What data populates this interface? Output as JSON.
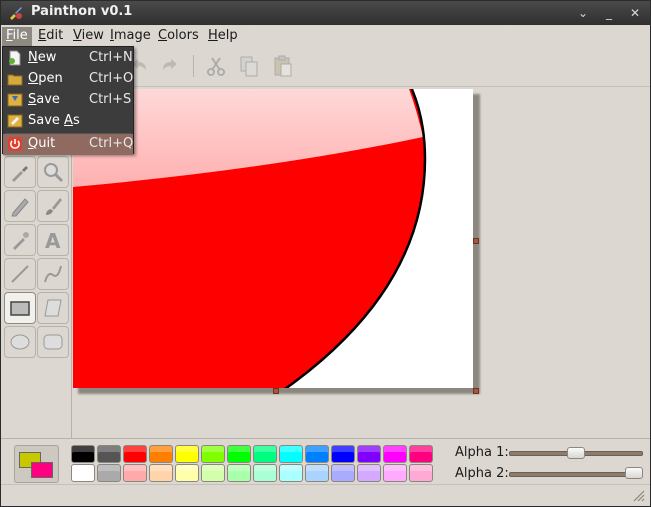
{
  "window": {
    "title": "Painthon v0.1",
    "controls": [
      "chevron-down",
      "minimize",
      "close"
    ]
  },
  "menubar": {
    "items": [
      {
        "label": "File",
        "mnemonic": "F",
        "rest": "ile"
      },
      {
        "label": "Edit",
        "mnemonic": "E",
        "rest": "dit"
      },
      {
        "label": "View",
        "mnemonic": "V",
        "rest": "iew"
      },
      {
        "label": "Image",
        "mnemonic": "I",
        "rest": "mage"
      },
      {
        "label": "Colors",
        "mnemonic": "C",
        "rest": "olors"
      },
      {
        "label": "Help",
        "mnemonic": "H",
        "rest": "elp"
      }
    ],
    "active": "File"
  },
  "file_menu": {
    "items": [
      {
        "label": "New",
        "mnemonic": "N",
        "rest": "ew",
        "accel": "Ctrl+N",
        "icon": "new-document-icon"
      },
      {
        "label": "Open",
        "mnemonic": "O",
        "rest": "pen",
        "accel": "Ctrl+O",
        "icon": "open-folder-icon"
      },
      {
        "label": "Save",
        "mnemonic": "S",
        "rest": "ave",
        "accel": "Ctrl+S",
        "icon": "save-icon"
      },
      {
        "label": "Save As",
        "mnemonic_pre": "Save ",
        "mnemonic": "A",
        "rest": "s",
        "accel": "",
        "icon": "save-as-icon"
      },
      {
        "label": "Quit",
        "mnemonic": "Q",
        "rest": "uit",
        "accel": "Ctrl+Q",
        "icon": "quit-icon"
      }
    ],
    "highlighted": "Quit"
  },
  "toolbar": {
    "buttons": [
      "undo-icon",
      "redo-icon",
      "cut-icon",
      "copy-icon",
      "paste-icon"
    ]
  },
  "tools": [
    "color-picker-icon",
    "magnifier-icon",
    "pencil-icon",
    "paintbrush-icon",
    "airbrush-icon",
    "text-icon",
    "line-icon",
    "curve-icon",
    "rectangle-icon",
    "free-shape-icon",
    "ellipse-icon",
    "rounded-rectangle-icon"
  ],
  "active_tool": "rectangle-icon",
  "palette": {
    "row1": [
      "#000000",
      "#555555",
      "#ff0000",
      "#ff7f00",
      "#ffff00",
      "#80ff00",
      "#00ff00",
      "#00ff80",
      "#00ffff",
      "#0080ff",
      "#0000ff",
      "#8000ff",
      "#ff00ff",
      "#ff0080"
    ],
    "row2": [
      "#ffffff",
      "#aaaaaa",
      "#ffaaaa",
      "#ffd4aa",
      "#ffffaa",
      "#d4ffaa",
      "#aaffaa",
      "#aaffd4",
      "#aaffff",
      "#aad4ff",
      "#aaaaff",
      "#d4aaff",
      "#ffaaff",
      "#ffaad4"
    ],
    "primary": "#c8c800",
    "secondary": "#ff0080"
  },
  "alpha": {
    "alpha1_label": "Alpha 1:",
    "alpha1_value": 0.5,
    "alpha2_label": "Alpha 2:",
    "alpha2_value": 1.0
  },
  "canvas": {
    "fill": "#ff0000",
    "stroke": "#000000"
  }
}
